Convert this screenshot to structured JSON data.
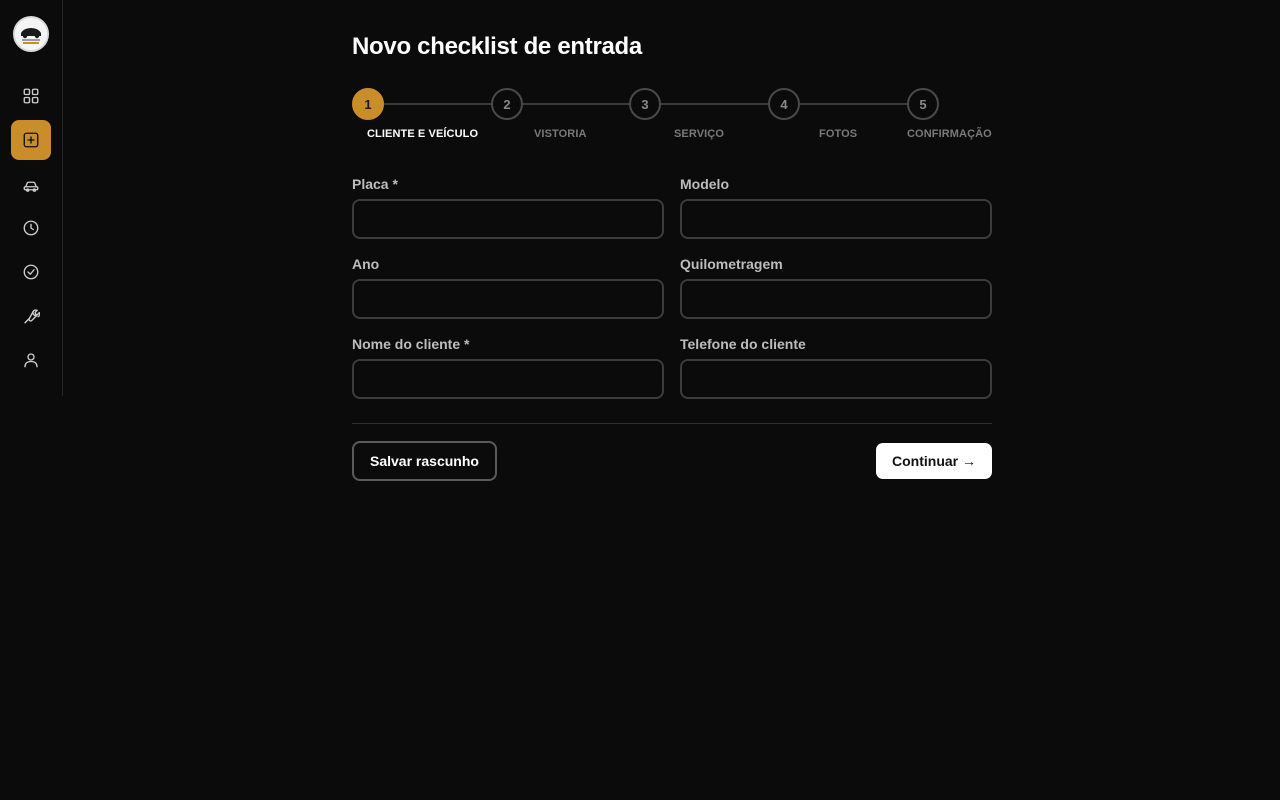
{
  "sidebar": {
    "logo_icon": "workshop-logo-icon",
    "items": [
      {
        "icon": "dashboard-grid-icon",
        "active": false
      },
      {
        "icon": "plus-square-icon",
        "active": true
      },
      {
        "icon": "car-icon",
        "active": false
      },
      {
        "icon": "clock-icon",
        "active": false
      },
      {
        "icon": "check-circle-icon",
        "active": false
      },
      {
        "icon": "wrench-icon",
        "active": false
      },
      {
        "icon": "user-icon",
        "active": false
      }
    ]
  },
  "page": {
    "title": "Novo checklist de entrada"
  },
  "stepper": {
    "current": 1,
    "steps": [
      {
        "number": "1",
        "label": "CLIENTE E VEÍCULO"
      },
      {
        "number": "2",
        "label": "VISTORIA"
      },
      {
        "number": "3",
        "label": "SERVIÇO"
      },
      {
        "number": "4",
        "label": "FOTOS"
      },
      {
        "number": "5",
        "label": "CONFIRMAÇÃO"
      }
    ]
  },
  "form": {
    "placa": {
      "label": "Placa *",
      "value": ""
    },
    "modelo": {
      "label": "Modelo",
      "value": ""
    },
    "ano": {
      "label": "Ano",
      "value": ""
    },
    "quilometragem": {
      "label": "Quilometragem",
      "value": ""
    },
    "nome_cliente": {
      "label": "Nome do cliente *",
      "value": ""
    },
    "telefone_cliente": {
      "label": "Telefone do cliente",
      "value": ""
    }
  },
  "actions": {
    "save_draft_label": "Salvar rascunho",
    "continue_label": "Continuar →"
  },
  "colors": {
    "accent": "#c98e2a",
    "background": "#0b0b0b"
  }
}
